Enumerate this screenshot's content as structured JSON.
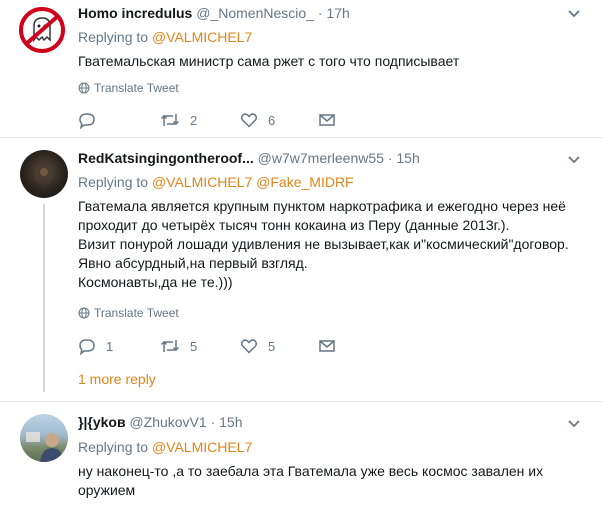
{
  "tweets": [
    {
      "name": "Homo incredulus",
      "handle": "@_NomenNescio_",
      "separator": "·",
      "time": "17h",
      "replying_prefix": "Replying to",
      "replying_to": "@VALMICHEL7",
      "replying_to_2": "",
      "lines": [
        "Гватемальская министр сама ржет с того что подписывает"
      ],
      "translate": "Translate Tweet",
      "replies": "",
      "retweets": "2",
      "likes": "6",
      "avatar": "ghost-logo-avatar"
    },
    {
      "name": "RedKatsingingontheroof...",
      "handle": "@w7w7merleenw55",
      "separator": "·",
      "time": "15h",
      "replying_prefix": "Replying to",
      "replying_to": "@VALMICHEL7",
      "replying_to_2": "@Fake_MIDRF",
      "lines": [
        "Гватемала является крупным пунктом наркотрафика и ежегодно через неё",
        "проходит до четырёх тысяч тонн кокаина из Перу (данные 2013г.).",
        "Визит понурой лошади удивления не вызывает,как и\"космический\"договор.",
        "Явно абсурдный,на первый взгляд.",
        "Космонавты,да не те.)))"
      ],
      "translate": "Translate Tweet",
      "replies": "1",
      "retweets": "5",
      "likes": "5",
      "avatar": "dark-photo-avatar",
      "more_replies": "1 more reply"
    },
    {
      "name": "}|{ykoв",
      "handle": "@ZhukovV1",
      "separator": "·",
      "time": "15h",
      "replying_prefix": "Replying to",
      "replying_to": "@VALMICHEL7",
      "replying_to_2": "",
      "lines": [
        "ну наконец-то ,а то заебала эта Гватемала уже весь космос завален их",
        "оружием"
      ],
      "avatar": "person-photo-avatar"
    }
  ],
  "colors": {
    "accent": "#e0841a",
    "muted": "#657786",
    "text": "#14171a",
    "divider": "#e6ecf0"
  }
}
